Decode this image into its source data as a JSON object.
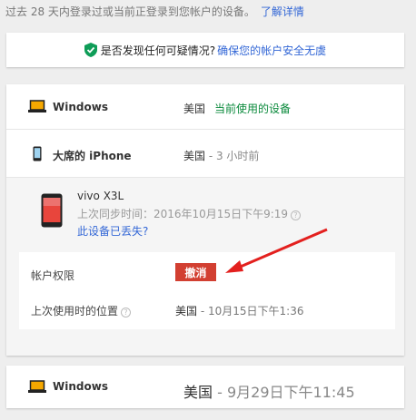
{
  "intro": {
    "text": "过去 28 天内登录过或当前正登录到您帐户的设备。",
    "link": "了解详情"
  },
  "alert": {
    "question": "是否发现任何可疑情况?",
    "link": "确保您的帐户安全无虞",
    "icon": "shield-check-icon",
    "icon_color": "#0f9d58"
  },
  "devices": [
    {
      "icon": "laptop-icon",
      "name": "Windows",
      "location": "美国",
      "current": "当前使用的设备"
    },
    {
      "icon": "phone-icon",
      "name": "大席的 iPhone",
      "location": "美国",
      "separator": " - ",
      "time": "3 小时前"
    }
  ],
  "expanded": {
    "name": "vivo X3L",
    "last_sync": "上次同步时间：2016年10月15日下午9:19",
    "help": "?",
    "lost_link": "此设备已丢失?",
    "permissions_label": "帐户权限",
    "revoke_button": "撤消",
    "last_location_label": "上次使用时的位置",
    "last_location_value": "美国",
    "last_location_sep": " - ",
    "last_location_time": "10月15日下午1:36"
  },
  "last_device": {
    "icon": "laptop-icon",
    "name": "Windows",
    "location": "美国",
    "separator": " - ",
    "time": "9月29日下午11:45"
  },
  "colors": {
    "link": "#3367d6",
    "current": "#0b8a3c",
    "revoke": "#d23f31",
    "arrow": "#e3201e",
    "laptop": "#f6a800"
  }
}
